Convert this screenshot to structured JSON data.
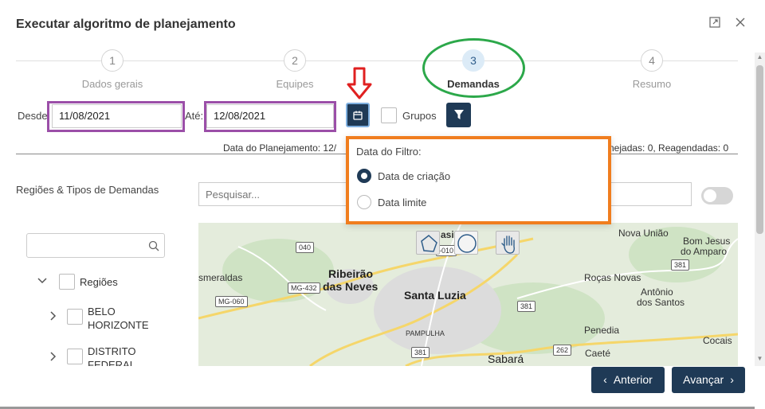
{
  "dialog": {
    "title": "Executar algoritmo de planejamento",
    "expand_icon": "expand-icon",
    "close_icon": "close-icon"
  },
  "steps": [
    {
      "number": "1",
      "label": "Dados gerais",
      "active": false
    },
    {
      "number": "2",
      "label": "Equipes",
      "active": false
    },
    {
      "number": "3",
      "label": "Demandas",
      "active": true
    },
    {
      "number": "4",
      "label": "Resumo",
      "active": false
    }
  ],
  "filters": {
    "from_label": "Desde",
    "from_value": "11/08/2021",
    "to_label": "Até:",
    "to_value": "12/08/2021",
    "calendar_icon": "calendar-icon",
    "groups_label": "Grupos",
    "filter_icon": "filter-icon"
  },
  "info": {
    "left": "Data do Planejamento: 12/",
    "right": "nejadas: 0, Reagendadas: 0"
  },
  "regions": {
    "label": "Regiões & Tipos de Demandas",
    "search_placeholder": "Pesquisar...",
    "tree": {
      "root": "Regiões",
      "items": [
        "BELO HORIZONTE",
        "DISTRITO FEDERAL"
      ]
    }
  },
  "popup": {
    "title": "Data do Filtro:",
    "options": [
      {
        "label": "Data de criação",
        "checked": true
      },
      {
        "label": "Data limite",
        "checked": false
      }
    ]
  },
  "map": {
    "places": [
      "Ribeirão",
      "das Neves",
      "smeraldas",
      "Santa Luzia",
      "PAMPULHA",
      "Sabará",
      "Nova União",
      "Bom Jesus",
      "do Amparo",
      "Roças Novas",
      "Antônio",
      "dos Santos",
      "Penedia",
      "Caeté",
      "Cocais",
      "asi"
    ],
    "roads": [
      "040",
      "MG-432",
      "MG-060",
      "381",
      "381",
      "262",
      "381",
      "-010"
    ]
  },
  "footer": {
    "back_label": "Anterior",
    "next_label": "Avançar"
  },
  "colors": {
    "primary": "#1f3a56",
    "annotation_green": "#2ca84a",
    "annotation_purple": "#9b4fa8",
    "annotation_orange": "#f07d1e",
    "annotation_red": "#e02020"
  }
}
